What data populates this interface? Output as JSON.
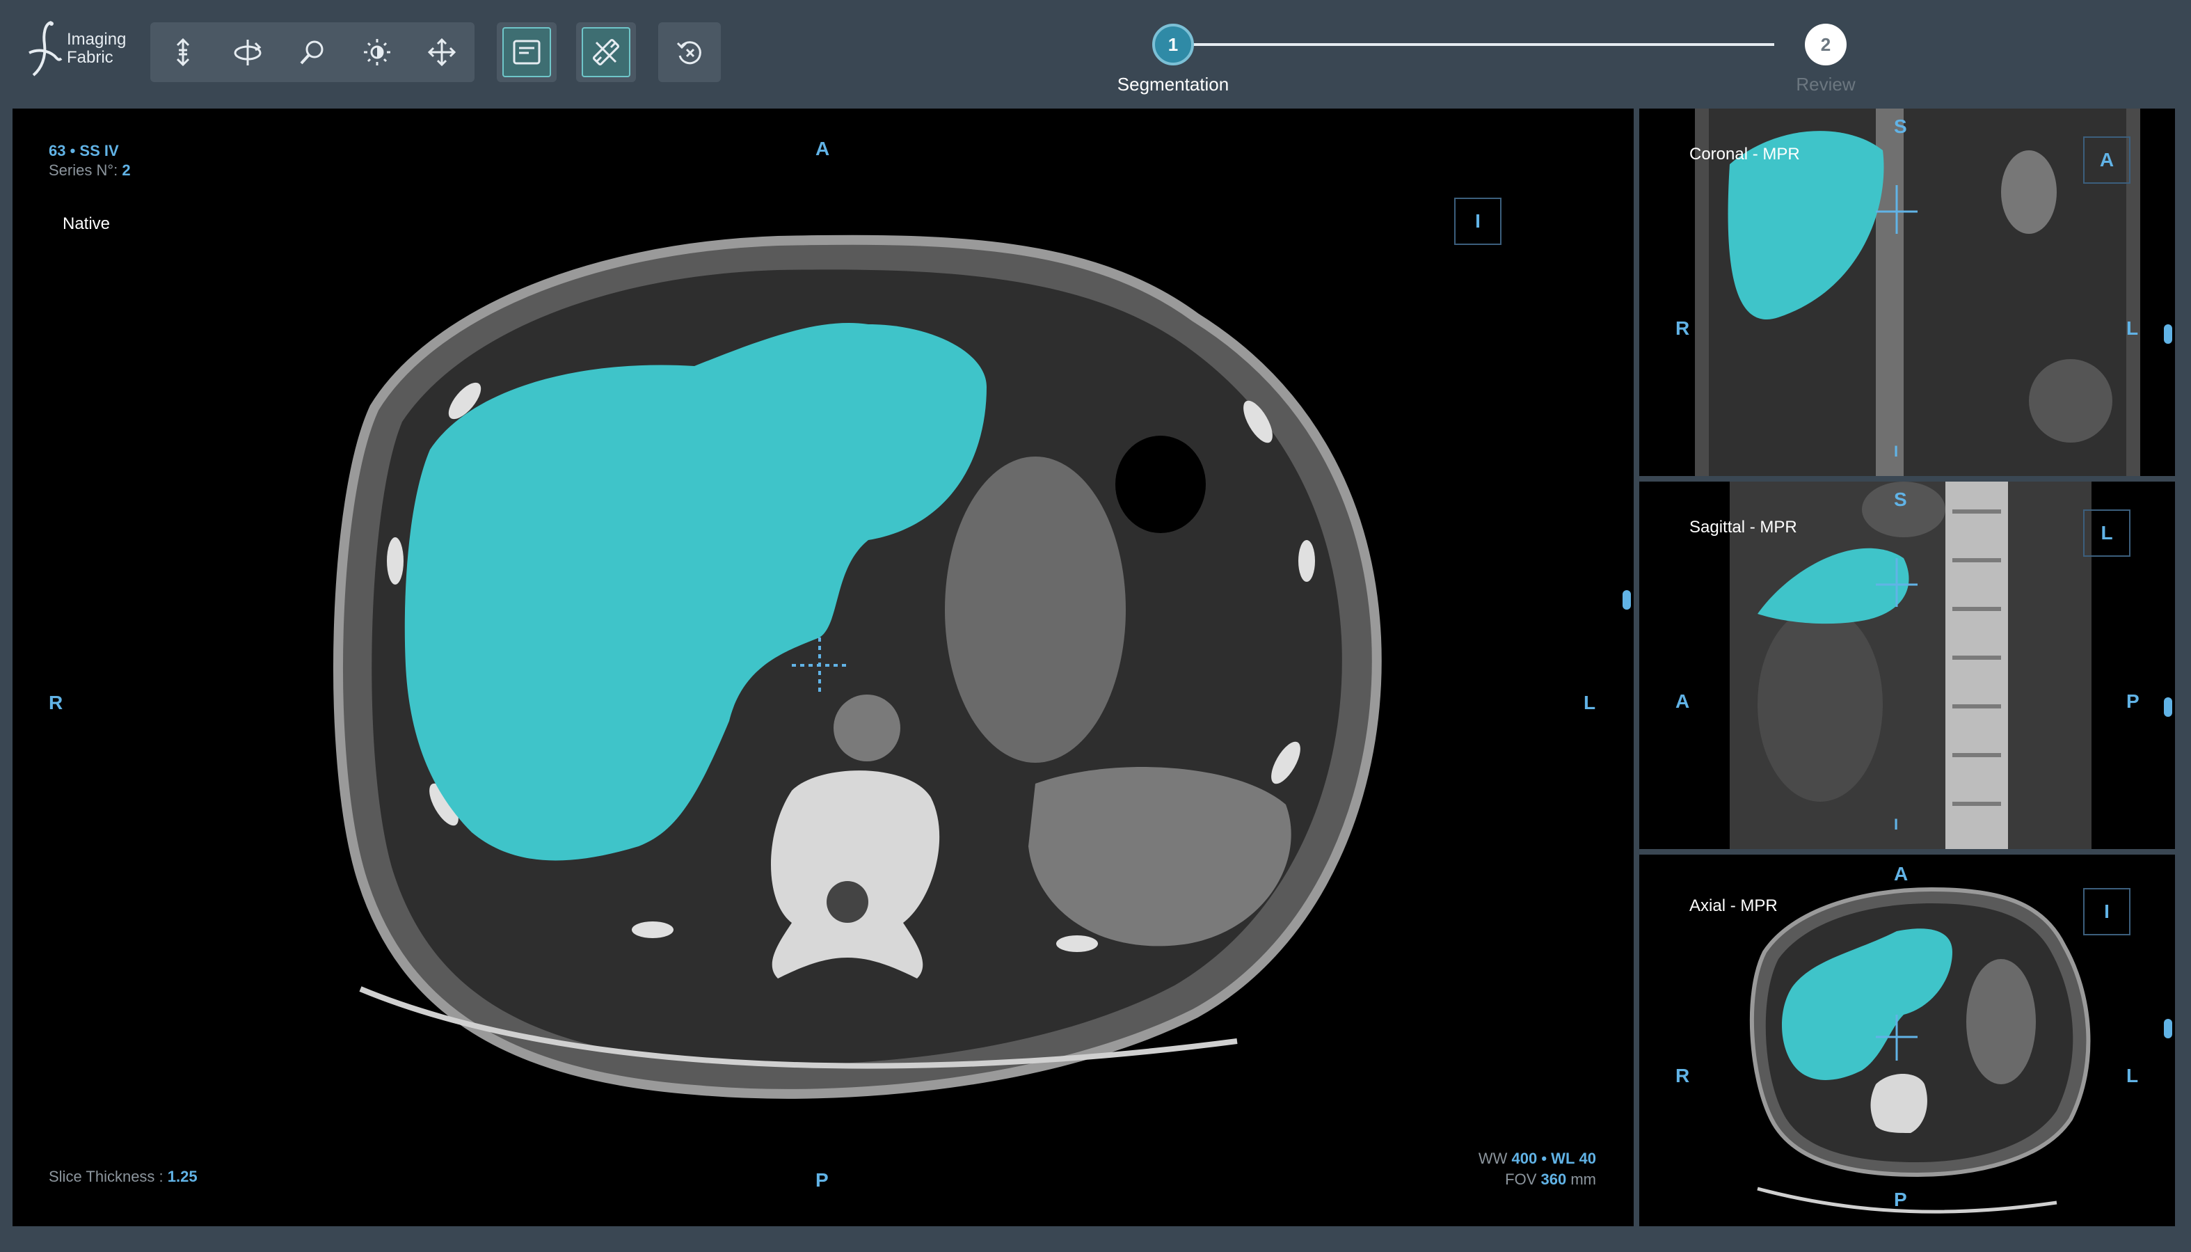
{
  "app": {
    "logo_line1": "Imaging",
    "logo_line2": "Fabric"
  },
  "toolbar": {
    "tools": [
      "scroll-icon",
      "rotate-icon",
      "zoom-icon",
      "brightness-icon",
      "pan-icon"
    ],
    "toggle_annotations": "annotations-icon",
    "toggle_measure": "measure-icon",
    "reset": "reset-icon"
  },
  "stepper": {
    "steps": [
      {
        "number": "1",
        "label": "Segmentation",
        "state": "active"
      },
      {
        "number": "2",
        "label": "Review",
        "state": "inactive"
      }
    ]
  },
  "main_view": {
    "patient": "63 • SS IV",
    "series_label": "Series N°:",
    "series_value": "2",
    "mode": "Native",
    "orient_top": "A",
    "orient_bottom": "P",
    "orient_left": "R",
    "orient_right": "L",
    "orient_box": "I",
    "slice_thickness_label": "Slice Thickness :",
    "slice_thickness_value": "1.25",
    "ww_label": "WW",
    "ww_value": "400",
    "wl_label": "• WL",
    "wl_value": "40",
    "fov_label": "FOV",
    "fov_value": "360",
    "fov_unit": "mm"
  },
  "coronal_view": {
    "title": "Coronal - MPR",
    "orient_top": "S",
    "orient_bottom": "I",
    "orient_left": "R",
    "orient_right": "L",
    "orient_box": "A"
  },
  "sagittal_view": {
    "title": "Sagittal - MPR",
    "orient_top": "S",
    "orient_bottom": "I",
    "orient_left": "A",
    "orient_right": "P",
    "orient_box": "L"
  },
  "axial_view": {
    "title": "Axial - MPR",
    "orient_top": "A",
    "orient_bottom": "P",
    "orient_left": "R",
    "orient_right": "L",
    "orient_box": "I"
  },
  "colors": {
    "segmentation": "#3fc4c9",
    "accent": "#61b3e6",
    "stepper_active": "#2f8aa6"
  }
}
